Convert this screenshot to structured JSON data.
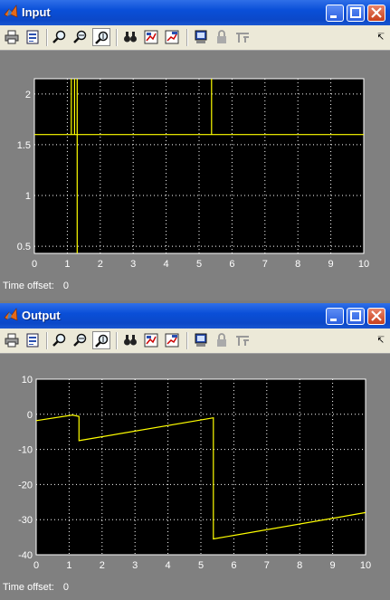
{
  "windows": [
    {
      "title": "Input",
      "time_offset_label": "Time offset:",
      "time_offset_value": "0"
    },
    {
      "title": "Output",
      "time_offset_label": "Time offset:",
      "time_offset_value": "0"
    }
  ],
  "toolbar_icons": [
    "print-icon",
    "parameters-icon",
    "zoom-icon",
    "zoom-x-icon",
    "zoom-y-icon",
    "autoscale-icon",
    "save-axes-icon",
    "restore-axes-icon",
    "floating-scope-icon",
    "lock-axes-icon",
    "signal-selection-icon"
  ],
  "colors": {
    "plot_bg": "#000000",
    "trace": "#ffff00",
    "frame": "#808080",
    "titlebar": "#0a4fd8"
  },
  "chart_data": [
    {
      "type": "line",
      "title": "",
      "xlim": [
        0,
        10
      ],
      "ylim": [
        0.43,
        2.15
      ],
      "xticks": [
        "0",
        "1",
        "2",
        "3",
        "4",
        "5",
        "6",
        "7",
        "8",
        "9",
        "10"
      ],
      "yticks": [
        "0.5",
        "1",
        "1.5",
        "2"
      ],
      "ytick_values": [
        0.5,
        1,
        1.5,
        2
      ],
      "grid": true,
      "series": [
        {
          "x": [
            0,
            1.12,
            1.12,
            1.12,
            1.12,
            1.22,
            1.22,
            1.22,
            1.22,
            1.3,
            1.3,
            1.3,
            1.3,
            1.3,
            5.38,
            5.38,
            5.38,
            5.38,
            10
          ],
          "y": [
            1.6,
            1.6,
            1.85,
            2.15,
            1.6,
            1.6,
            2.15,
            1.6,
            1.6,
            1.6,
            2.15,
            0.43,
            1.6,
            1.6,
            1.6,
            2.15,
            1.85,
            1.6,
            1.6
          ]
        }
      ]
    },
    {
      "type": "line",
      "title": "",
      "xlim": [
        0,
        10
      ],
      "ylim": [
        -40,
        10
      ],
      "xticks": [
        "0",
        "1",
        "2",
        "3",
        "4",
        "5",
        "6",
        "7",
        "8",
        "9",
        "10"
      ],
      "yticks": [
        "-40",
        "-30",
        "-20",
        "-10",
        "0",
        "10"
      ],
      "ytick_values": [
        -40,
        -30,
        -20,
        -10,
        0,
        10
      ],
      "grid": true,
      "series": [
        {
          "x": [
            0,
            1.1,
            1.3,
            1.3,
            5.38,
            5.38,
            10
          ],
          "y": [
            -1.8,
            -0.2,
            -0.6,
            -7.5,
            -1.0,
            -35.5,
            -28.0
          ]
        }
      ]
    }
  ]
}
